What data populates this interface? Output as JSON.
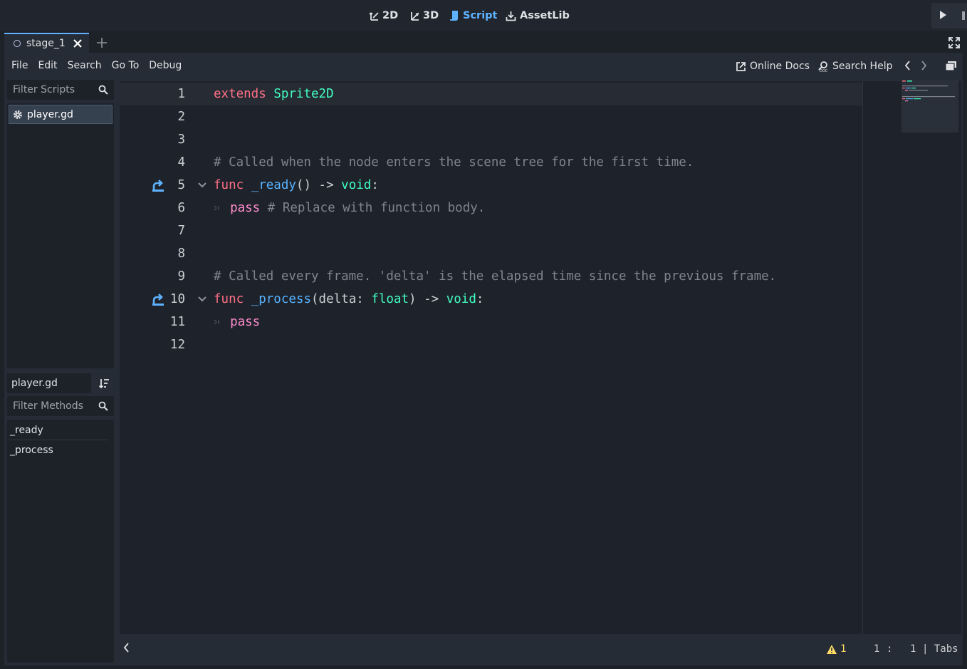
{
  "topbar": {
    "workspaces": [
      {
        "label": "2D",
        "icon": "2d-icon"
      },
      {
        "label": "3D",
        "icon": "3d-icon"
      },
      {
        "label": "Script",
        "icon": "script-icon",
        "active": true
      },
      {
        "label": "AssetLib",
        "icon": "assetlib-icon"
      }
    ],
    "accent_color": "#5fb2ff"
  },
  "tabs": [
    {
      "label": "stage_1",
      "icon": "scene-circle-icon"
    }
  ],
  "menu": [
    "File",
    "Edit",
    "Search",
    "Go To",
    "Debug"
  ],
  "toolbar_right": {
    "online_docs": "Online Docs",
    "search_help": "Search Help"
  },
  "scripts_panel": {
    "filter_placeholder": "Filter Scripts",
    "items": [
      {
        "label": "player.gd",
        "icon": "gear-icon"
      }
    ]
  },
  "methods_panel": {
    "current_script": "player.gd",
    "filter_placeholder": "Filter Methods",
    "items": [
      "_ready",
      "_process"
    ]
  },
  "editor": {
    "line_numbers": [
      "1",
      "2",
      "3",
      "4",
      "5",
      "6",
      "7",
      "8",
      "9",
      "10",
      "11",
      "12"
    ],
    "lines": {
      "l1": {
        "kw": "extends",
        "type": "Sprite2D"
      },
      "l4": {
        "comment": "# Called when the node enters the scene tree for the first time."
      },
      "l5": {
        "kw": "func",
        "name": "_ready",
        "args": "()",
        "arrow": "->",
        "ret": "void",
        "colon": ":"
      },
      "l6": {
        "kw": "pass",
        "comment": "# Replace with function body."
      },
      "l9": {
        "comment": "# Called every frame. 'delta' is the elapsed time since the previous frame."
      },
      "l10": {
        "kw": "func",
        "name": "_process",
        "open": "(",
        "param": "delta",
        "sep": ":",
        "ptype": "float",
        "close": ")",
        "arrow": "->",
        "ret": "void",
        "colon": ":"
      },
      "l11": {
        "kw": "pass"
      }
    },
    "colors": {
      "keyword": "#ff7085",
      "type": "#42ffc2",
      "function": "#57b3ff",
      "comment": "#7f858d",
      "control": "#ff8ccc"
    }
  },
  "status": {
    "warnings": "1",
    "line": "1",
    "sep": ":",
    "col": "1",
    "indent": "| Tabs"
  }
}
